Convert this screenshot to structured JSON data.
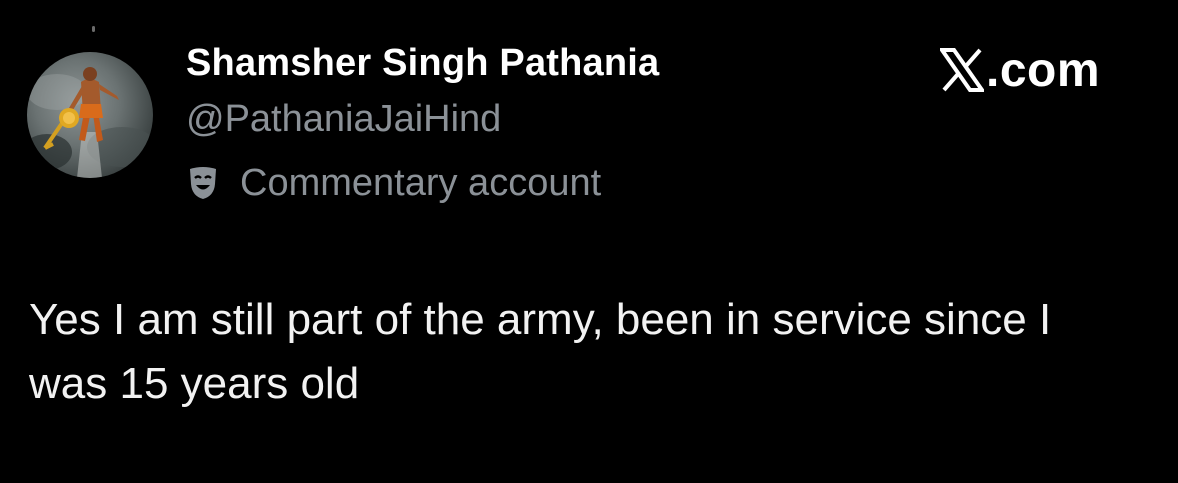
{
  "author": {
    "display_name": "Shamsher Singh Pathania",
    "handle": "@PathaniaJaiHind",
    "account_label": "Commentary account",
    "account_label_icon": "theater-mask-icon",
    "avatar_icon": "avatar-flying-figure"
  },
  "brand": {
    "text": ".com",
    "logo_icon": "x-logo-icon"
  },
  "tweet": {
    "text": "Yes I am still part of the army, been in service since I was 15 years old"
  },
  "colors": {
    "background": "#000000",
    "primary_text": "#ffffff",
    "secondary_text": "#8b9197"
  }
}
